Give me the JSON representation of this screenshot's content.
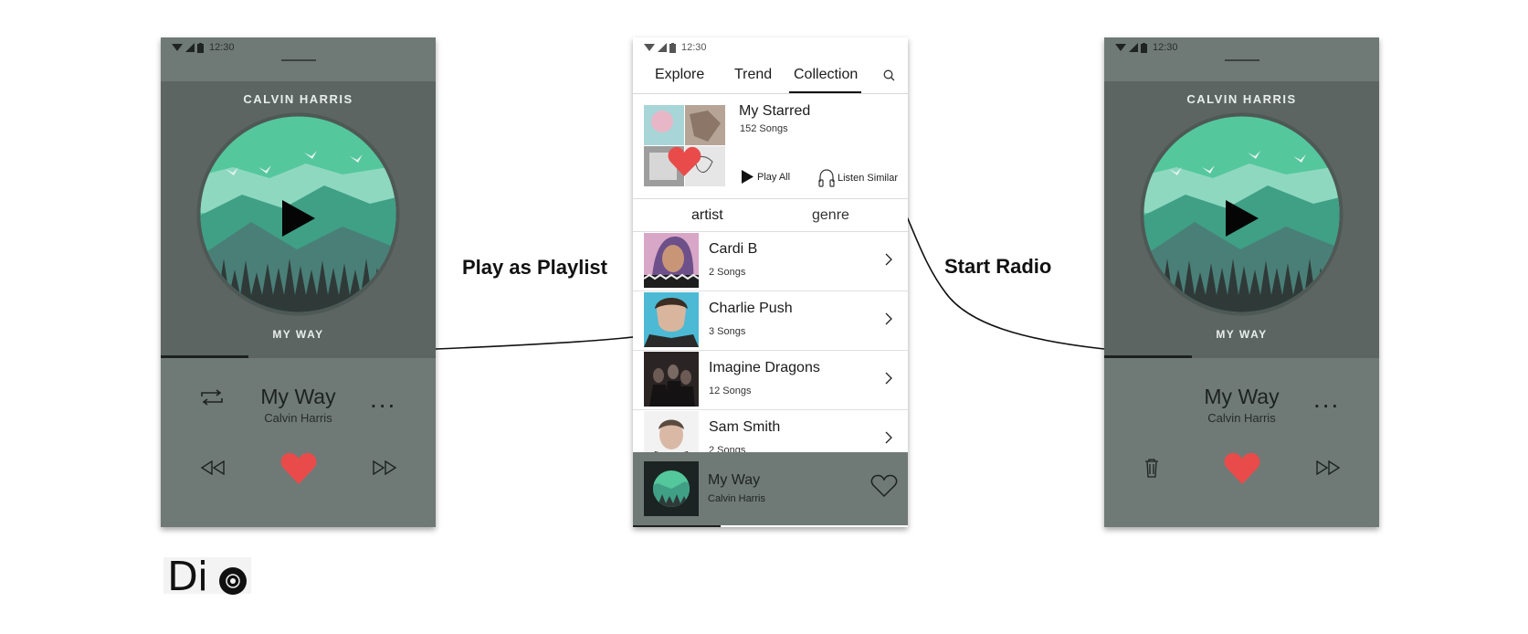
{
  "status": {
    "time": "12:30"
  },
  "player_left": {
    "artist_caption": "CALVIN HARRIS",
    "song_caption": "MY WAY",
    "title": "My Way",
    "artist": "Calvin Harris",
    "more_label": "...",
    "progress": 0.32,
    "icons": [
      "repeat-icon",
      "rewind-icon",
      "heart-icon",
      "fast-forward-icon"
    ]
  },
  "collection": {
    "tabs": [
      "Explore",
      "Trend",
      "Collection"
    ],
    "active_tab": "Collection",
    "starred": {
      "title": "My Starred",
      "count": "152 Songs",
      "play_all": "Play All",
      "listen_similar": "Listen Similar"
    },
    "subtabs": [
      "artist",
      "genre"
    ],
    "active_subtab": "artist",
    "artists": [
      {
        "name": "Cardi B",
        "count": "2 Songs"
      },
      {
        "name": "Charlie Push",
        "count": "3 Songs"
      },
      {
        "name": "Imagine Dragons",
        "count": "12 Songs"
      },
      {
        "name": "Sam Smith",
        "count": "2 Songs"
      }
    ],
    "mini_player": {
      "title": "My Way",
      "artist": "Calvin Harris",
      "progress": 0.32
    }
  },
  "player_right": {
    "artist_caption": "CALVIN HARRIS",
    "song_caption": "MY WAY",
    "title": "My Way",
    "artist": "Calvin Harris",
    "more_label": "...",
    "progress": 0.32,
    "icons": [
      "trash-icon",
      "heart-icon",
      "fast-forward-icon"
    ]
  },
  "annotations": {
    "left": "Play as Playlist",
    "right": "Start Radio"
  },
  "logo": {
    "text": "Di"
  },
  "colors": {
    "heart": "#e94b4b",
    "player_bg": "#6f7a76",
    "album_teal": "#5ab99a"
  }
}
